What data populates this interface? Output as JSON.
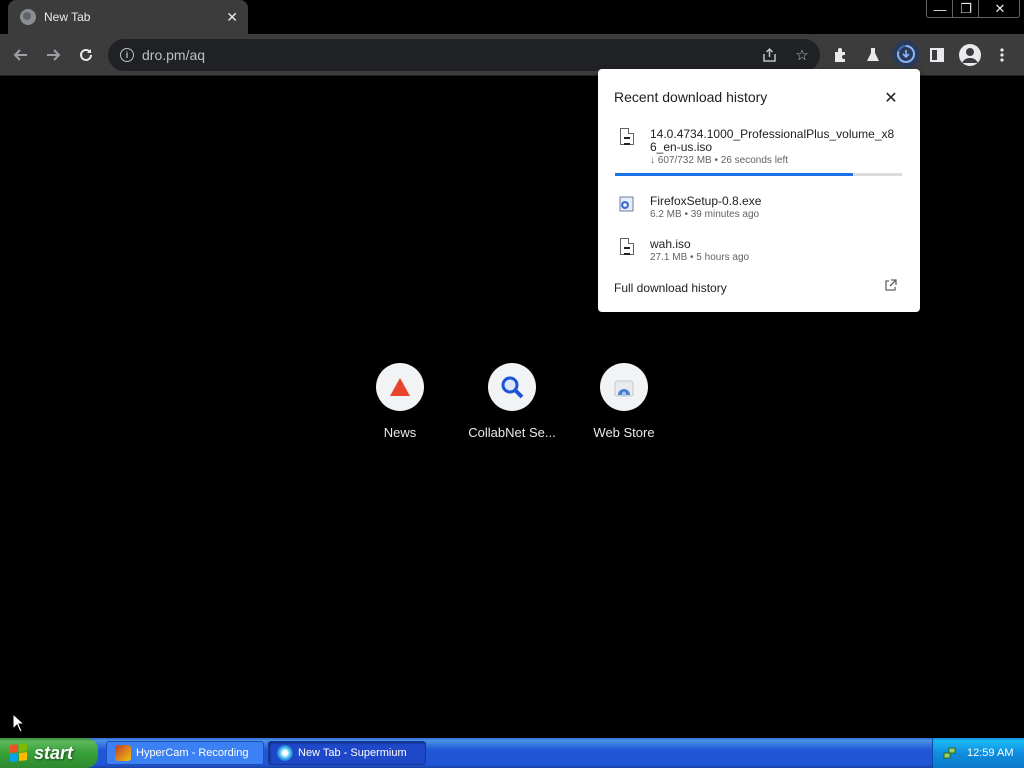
{
  "browser": {
    "tab": {
      "title": "New Tab"
    },
    "window_controls": {
      "minimize": "—",
      "maximize": "❐",
      "close": "✕"
    },
    "address_bar": {
      "url": "dro.pm/aq"
    }
  },
  "downloads_bubble": {
    "title": "Recent download history",
    "items": [
      {
        "filename": "14.0.4734.1000_ProfessionalPlus_volume_x86_en-us.iso",
        "filename_display": "14.0.4734.1000_ProfessionalPlus_volume_x8 6_en-us.iso",
        "status": "↓ 607/732 MB • 26 seconds left",
        "progress": 0.83
      },
      {
        "filename": "FirefoxSetup-0.8.exe",
        "status": "6.2 MB • 39 minutes ago"
      },
      {
        "filename": "wah.iso",
        "status": "27.1 MB • 5 hours ago"
      }
    ],
    "footer_link": "Full download history"
  },
  "shortcuts": [
    {
      "label": "News",
      "icon": "triangle-icon"
    },
    {
      "label": "CollabNet Se...",
      "icon": "magnifier-icon"
    },
    {
      "label": "Web Store",
      "icon": "webstore-icon"
    }
  ],
  "taskbar": {
    "start_label": "start",
    "tasks": [
      {
        "label": "HyperCam - Recording",
        "active": false
      },
      {
        "label": "New Tab - Supermium",
        "active": true
      }
    ],
    "clock": "12:59 AM"
  },
  "colors": {
    "accent": "#1a73e8",
    "toolbar": "#3c3c3c",
    "news_icon": "#e8442c",
    "search_icon": "#1a55d6"
  }
}
